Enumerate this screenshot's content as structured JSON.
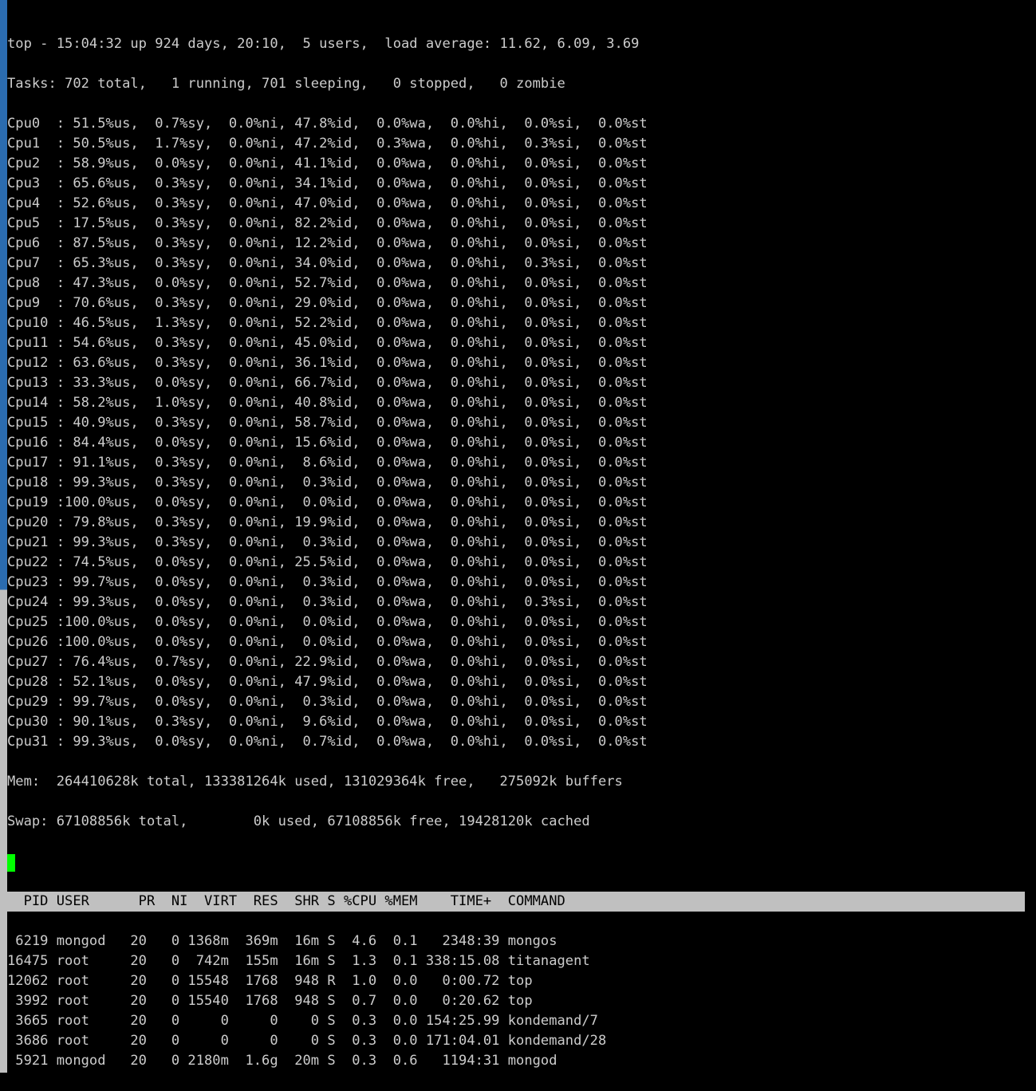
{
  "summary": {
    "line1": "top - 15:04:32 up 924 days, 20:10,  5 users,  load average: 11.62, 6.09, 3.69",
    "line2": "Tasks: 702 total,   1 running, 701 sleeping,   0 stopped,   0 zombie"
  },
  "cpus": [
    {
      "n": "Cpu0 ",
      "us": " 51.5",
      "sy": " 0.7",
      "ni": " 0.0",
      "id": "47.8",
      "wa": " 0.0",
      "hi": " 0.0",
      "si": " 0.0",
      "st": " 0.0"
    },
    {
      "n": "Cpu1 ",
      "us": " 50.5",
      "sy": " 1.7",
      "ni": " 0.0",
      "id": "47.2",
      "wa": " 0.3",
      "hi": " 0.0",
      "si": " 0.3",
      "st": " 0.0"
    },
    {
      "n": "Cpu2 ",
      "us": " 58.9",
      "sy": " 0.0",
      "ni": " 0.0",
      "id": "41.1",
      "wa": " 0.0",
      "hi": " 0.0",
      "si": " 0.0",
      "st": " 0.0"
    },
    {
      "n": "Cpu3 ",
      "us": " 65.6",
      "sy": " 0.3",
      "ni": " 0.0",
      "id": "34.1",
      "wa": " 0.0",
      "hi": " 0.0",
      "si": " 0.0",
      "st": " 0.0"
    },
    {
      "n": "Cpu4 ",
      "us": " 52.6",
      "sy": " 0.3",
      "ni": " 0.0",
      "id": "47.0",
      "wa": " 0.0",
      "hi": " 0.0",
      "si": " 0.0",
      "st": " 0.0"
    },
    {
      "n": "Cpu5 ",
      "us": " 17.5",
      "sy": " 0.3",
      "ni": " 0.0",
      "id": "82.2",
      "wa": " 0.0",
      "hi": " 0.0",
      "si": " 0.0",
      "st": " 0.0"
    },
    {
      "n": "Cpu6 ",
      "us": " 87.5",
      "sy": " 0.3",
      "ni": " 0.0",
      "id": "12.2",
      "wa": " 0.0",
      "hi": " 0.0",
      "si": " 0.0",
      "st": " 0.0"
    },
    {
      "n": "Cpu7 ",
      "us": " 65.3",
      "sy": " 0.3",
      "ni": " 0.0",
      "id": "34.0",
      "wa": " 0.0",
      "hi": " 0.0",
      "si": " 0.3",
      "st": " 0.0"
    },
    {
      "n": "Cpu8 ",
      "us": " 47.3",
      "sy": " 0.0",
      "ni": " 0.0",
      "id": "52.7",
      "wa": " 0.0",
      "hi": " 0.0",
      "si": " 0.0",
      "st": " 0.0"
    },
    {
      "n": "Cpu9 ",
      "us": " 70.6",
      "sy": " 0.3",
      "ni": " 0.0",
      "id": "29.0",
      "wa": " 0.0",
      "hi": " 0.0",
      "si": " 0.0",
      "st": " 0.0"
    },
    {
      "n": "Cpu10",
      "us": " 46.5",
      "sy": " 1.3",
      "ni": " 0.0",
      "id": "52.2",
      "wa": " 0.0",
      "hi": " 0.0",
      "si": " 0.0",
      "st": " 0.0"
    },
    {
      "n": "Cpu11",
      "us": " 54.6",
      "sy": " 0.3",
      "ni": " 0.0",
      "id": "45.0",
      "wa": " 0.0",
      "hi": " 0.0",
      "si": " 0.0",
      "st": " 0.0"
    },
    {
      "n": "Cpu12",
      "us": " 63.6",
      "sy": " 0.3",
      "ni": " 0.0",
      "id": "36.1",
      "wa": " 0.0",
      "hi": " 0.0",
      "si": " 0.0",
      "st": " 0.0"
    },
    {
      "n": "Cpu13",
      "us": " 33.3",
      "sy": " 0.0",
      "ni": " 0.0",
      "id": "66.7",
      "wa": " 0.0",
      "hi": " 0.0",
      "si": " 0.0",
      "st": " 0.0"
    },
    {
      "n": "Cpu14",
      "us": " 58.2",
      "sy": " 1.0",
      "ni": " 0.0",
      "id": "40.8",
      "wa": " 0.0",
      "hi": " 0.0",
      "si": " 0.0",
      "st": " 0.0"
    },
    {
      "n": "Cpu15",
      "us": " 40.9",
      "sy": " 0.3",
      "ni": " 0.0",
      "id": "58.7",
      "wa": " 0.0",
      "hi": " 0.0",
      "si": " 0.0",
      "st": " 0.0"
    },
    {
      "n": "Cpu16",
      "us": " 84.4",
      "sy": " 0.0",
      "ni": " 0.0",
      "id": "15.6",
      "wa": " 0.0",
      "hi": " 0.0",
      "si": " 0.0",
      "st": " 0.0"
    },
    {
      "n": "Cpu17",
      "us": " 91.1",
      "sy": " 0.3",
      "ni": " 0.0",
      "id": " 8.6",
      "wa": " 0.0",
      "hi": " 0.0",
      "si": " 0.0",
      "st": " 0.0"
    },
    {
      "n": "Cpu18",
      "us": " 99.3",
      "sy": " 0.3",
      "ni": " 0.0",
      "id": " 0.3",
      "wa": " 0.0",
      "hi": " 0.0",
      "si": " 0.0",
      "st": " 0.0"
    },
    {
      "n": "Cpu19",
      "us": "100.0",
      "sy": " 0.0",
      "ni": " 0.0",
      "id": " 0.0",
      "wa": " 0.0",
      "hi": " 0.0",
      "si": " 0.0",
      "st": " 0.0"
    },
    {
      "n": "Cpu20",
      "us": " 79.8",
      "sy": " 0.3",
      "ni": " 0.0",
      "id": "19.9",
      "wa": " 0.0",
      "hi": " 0.0",
      "si": " 0.0",
      "st": " 0.0"
    },
    {
      "n": "Cpu21",
      "us": " 99.3",
      "sy": " 0.3",
      "ni": " 0.0",
      "id": " 0.3",
      "wa": " 0.0",
      "hi": " 0.0",
      "si": " 0.0",
      "st": " 0.0"
    },
    {
      "n": "Cpu22",
      "us": " 74.5",
      "sy": " 0.0",
      "ni": " 0.0",
      "id": "25.5",
      "wa": " 0.0",
      "hi": " 0.0",
      "si": " 0.0",
      "st": " 0.0"
    },
    {
      "n": "Cpu23",
      "us": " 99.7",
      "sy": " 0.0",
      "ni": " 0.0",
      "id": " 0.3",
      "wa": " 0.0",
      "hi": " 0.0",
      "si": " 0.0",
      "st": " 0.0"
    },
    {
      "n": "Cpu24",
      "us": " 99.3",
      "sy": " 0.0",
      "ni": " 0.0",
      "id": " 0.3",
      "wa": " 0.0",
      "hi": " 0.0",
      "si": " 0.3",
      "st": " 0.0"
    },
    {
      "n": "Cpu25",
      "us": "100.0",
      "sy": " 0.0",
      "ni": " 0.0",
      "id": " 0.0",
      "wa": " 0.0",
      "hi": " 0.0",
      "si": " 0.0",
      "st": " 0.0"
    },
    {
      "n": "Cpu26",
      "us": "100.0",
      "sy": " 0.0",
      "ni": " 0.0",
      "id": " 0.0",
      "wa": " 0.0",
      "hi": " 0.0",
      "si": " 0.0",
      "st": " 0.0"
    },
    {
      "n": "Cpu27",
      "us": " 76.4",
      "sy": " 0.7",
      "ni": " 0.0",
      "id": "22.9",
      "wa": " 0.0",
      "hi": " 0.0",
      "si": " 0.0",
      "st": " 0.0"
    },
    {
      "n": "Cpu28",
      "us": " 52.1",
      "sy": " 0.0",
      "ni": " 0.0",
      "id": "47.9",
      "wa": " 0.0",
      "hi": " 0.0",
      "si": " 0.0",
      "st": " 0.0"
    },
    {
      "n": "Cpu29",
      "us": " 99.7",
      "sy": " 0.0",
      "ni": " 0.0",
      "id": " 0.3",
      "wa": " 0.0",
      "hi": " 0.0",
      "si": " 0.0",
      "st": " 0.0"
    },
    {
      "n": "Cpu30",
      "us": " 90.1",
      "sy": " 0.3",
      "ni": " 0.0",
      "id": " 9.6",
      "wa": " 0.0",
      "hi": " 0.0",
      "si": " 0.0",
      "st": " 0.0"
    },
    {
      "n": "Cpu31",
      "us": " 99.3",
      "sy": " 0.0",
      "ni": " 0.0",
      "id": " 0.7",
      "wa": " 0.0",
      "hi": " 0.0",
      "si": " 0.0",
      "st": " 0.0"
    }
  ],
  "mem": "Mem:  264410628k total, 133381264k used, 131029364k free,   275092k buffers",
  "swap": "Swap: 67108856k total,        0k used, 67108856k free, 19428120k cached",
  "header": "  PID USER      PR  NI  VIRT  RES  SHR S %CPU %MEM    TIME+  COMMAND",
  "procs": [
    {
      "pid": " 6219",
      "user": "mongod  ",
      "pr": "20",
      "ni": "  0",
      "virt": "1368m",
      "res": " 369m",
      "shr": " 16m",
      "s": "S",
      "cpu": " 4.6",
      "mem": " 0.1",
      "time": "  2348:39",
      "cmd": "mongos"
    },
    {
      "pid": "16475",
      "user": "root    ",
      "pr": "20",
      "ni": "  0",
      "virt": " 742m",
      "res": " 155m",
      "shr": " 16m",
      "s": "S",
      "cpu": " 1.3",
      "mem": " 0.1",
      "time": "338:15.08",
      "cmd": "titanagent"
    },
    {
      "pid": "12062",
      "user": "root    ",
      "pr": "20",
      "ni": "  0",
      "virt": "15548",
      "res": " 1768",
      "shr": " 948",
      "s": "R",
      "cpu": " 1.0",
      "mem": " 0.0",
      "time": "  0:00.72",
      "cmd": "top"
    },
    {
      "pid": " 3992",
      "user": "root    ",
      "pr": "20",
      "ni": "  0",
      "virt": "15540",
      "res": " 1768",
      "shr": " 948",
      "s": "S",
      "cpu": " 0.7",
      "mem": " 0.0",
      "time": "  0:20.62",
      "cmd": "top"
    },
    {
      "pid": " 3665",
      "user": "root    ",
      "pr": "20",
      "ni": "  0",
      "virt": "    0",
      "res": "    0",
      "shr": "   0",
      "s": "S",
      "cpu": " 0.3",
      "mem": " 0.0",
      "time": "154:25.99",
      "cmd": "kondemand/7"
    },
    {
      "pid": " 3686",
      "user": "root    ",
      "pr": "20",
      "ni": "  0",
      "virt": "    0",
      "res": "    0",
      "shr": "   0",
      "s": "S",
      "cpu": " 0.3",
      "mem": " 0.0",
      "time": "171:04.01",
      "cmd": "kondemand/28"
    },
    {
      "pid": " 5921",
      "user": "mongod  ",
      "pr": "20",
      "ni": "  0",
      "virt": "2180m",
      "res": " 1.6g",
      "shr": " 20m",
      "s": "S",
      "cpu": " 0.3",
      "mem": " 0.6",
      "time": "  1194:31",
      "cmd": "mongod"
    }
  ]
}
